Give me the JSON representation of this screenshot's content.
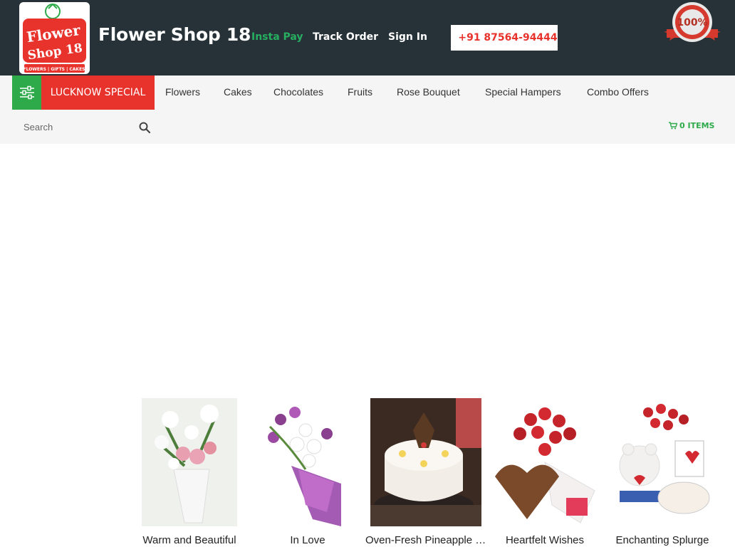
{
  "header": {
    "brand_name": "Flower Shop 18",
    "logo_text_line1": "Flower",
    "logo_text_line2": "Shop 18",
    "logo_tagline": "FLOWERS | GIFTS | CAKES",
    "links": {
      "insta_pay": "Insta Pay",
      "track_order": "Track Order",
      "sign_in": "Sign In"
    },
    "phone": "+91 87564-94444",
    "seal_text": "100%",
    "colors": {
      "bar": "#263238",
      "insta": "#27ae60",
      "phone": "#e8322c"
    }
  },
  "nav": {
    "special_label": "LUCKNOW SPECIAL",
    "items": [
      "Flowers",
      "Cakes",
      "Chocolates",
      "Fruits",
      "Rose Bouquet",
      "Special Hampers",
      "Combo Offers"
    ],
    "colors": {
      "filter_bg": "#2eaa4b",
      "special_bg": "#e8322c"
    }
  },
  "search": {
    "placeholder": "Search",
    "icon": "search-icon"
  },
  "cart": {
    "label": "0 ITEMS",
    "icon": "cart-icon"
  },
  "products": [
    {
      "name": "Warm and Beautiful"
    },
    {
      "name": "In Love"
    },
    {
      "name": "Oven-Fresh Pineapple Cake"
    },
    {
      "name": "Heartfelt Wishes"
    },
    {
      "name": "Enchanting Splurge"
    }
  ]
}
